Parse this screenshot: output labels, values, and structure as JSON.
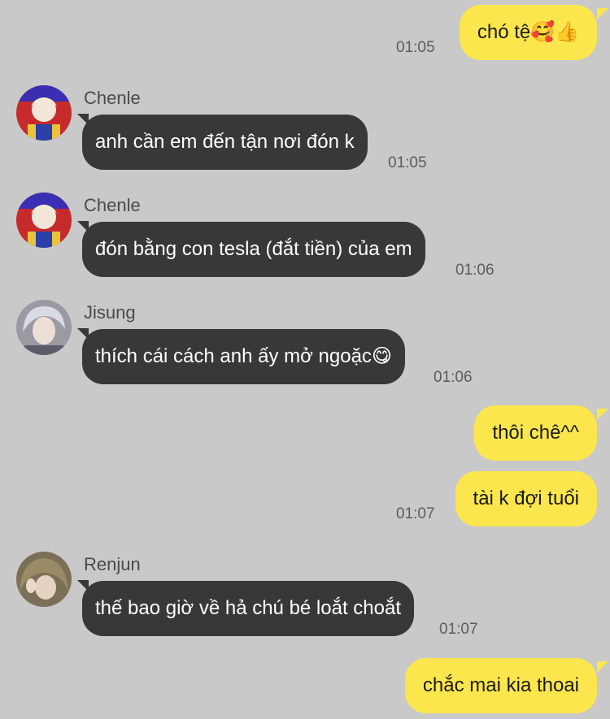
{
  "messages": {
    "m1": {
      "text": "chó tệ",
      "emoji": "🥰👍",
      "time": "01:05"
    },
    "m2": {
      "sender": "Chenle",
      "text": "anh cần em đến tận nơi đón k",
      "time": "01:05"
    },
    "m3": {
      "sender": "Chenle",
      "text": "đón bằng con tesla (đắt tiền) của em",
      "time": "01:06"
    },
    "m4": {
      "sender": "Jisung",
      "text": "thích cái cách anh ấy mở ngoặc",
      "emoji": "😋",
      "time": "01:06"
    },
    "m5": {
      "text": "thôi chê^^"
    },
    "m6": {
      "text": "tài k đợi tuổi",
      "time": "01:07"
    },
    "m7": {
      "sender": "Renjun",
      "text": "thế bao giờ về hả chú bé loắt choắt",
      "time": "01:07"
    },
    "m8": {
      "text": "chắc mai kia thoai"
    }
  },
  "colors": {
    "background": "#c9c9c9",
    "outgoing_bubble": "#fbe64d",
    "incoming_bubble": "#38383a"
  }
}
